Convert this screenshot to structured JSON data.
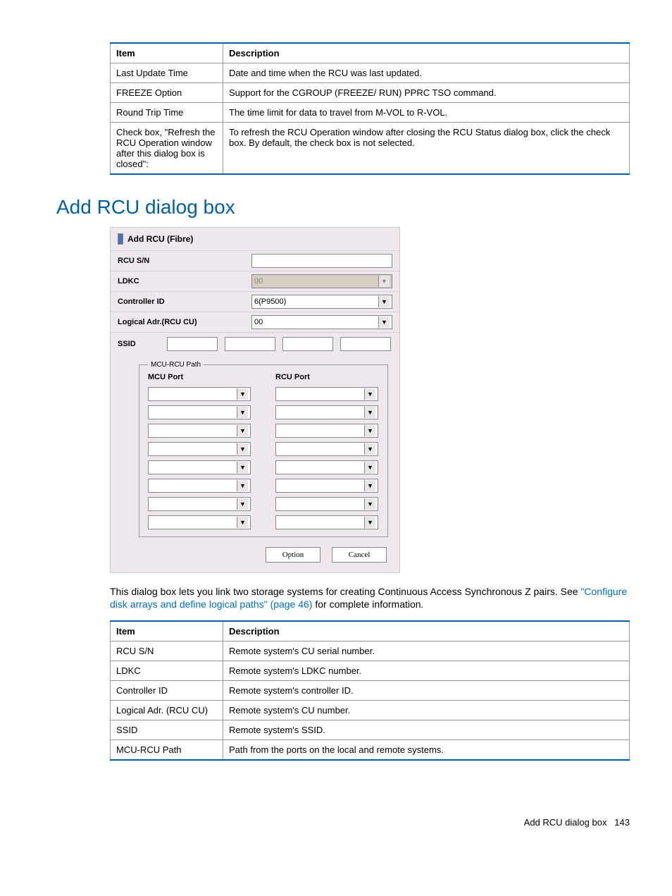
{
  "table1": {
    "headers": [
      "Item",
      "Description"
    ],
    "rows": [
      {
        "item": "Last Update Time",
        "desc": "Date and time when the RCU was last updated."
      },
      {
        "item": "FREEZE Option",
        "desc": "Support for the CGROUP (FREEZE/ RUN) PPRC TSO command."
      },
      {
        "item": "Round Trip Time",
        "desc": "The time limit for data to travel from M-VOL to R-VOL."
      },
      {
        "item": "Check box, \"Refresh the RCU Operation window after this dialog box is closed\":",
        "desc": "To refresh the RCU Operation window after closing the RCU Status dialog box, click the check box. By default, the check box is not selected."
      }
    ]
  },
  "section_title": "Add RCU dialog box",
  "dialog": {
    "title": "Add RCU (Fibre)",
    "labels": {
      "rcu_sn": "RCU S/N",
      "ldkc": "LDKC",
      "controller_id": "Controller ID",
      "logical_adr": "Logical Adr.(RCU CU)",
      "ssid": "SSID",
      "mcu_port": "MCU Port",
      "rcu_port": "RCU Port",
      "legend": "MCU-RCU Path"
    },
    "values": {
      "rcu_sn": "",
      "ldkc": "00",
      "controller_id": "6(P9500)",
      "logical_adr": "00"
    },
    "buttons": {
      "option": "Option",
      "cancel": "Cancel"
    },
    "path_rows": 8
  },
  "paragraph": {
    "pre": "This dialog box lets you link two storage systems for creating Continuous Access Synchronous Z pairs. See ",
    "link": "\"Configure disk arrays and define logical paths\" (page 46)",
    "post": " for complete information."
  },
  "table2": {
    "headers": [
      "Item",
      "Description"
    ],
    "rows": [
      {
        "item": "RCU S/N",
        "desc": "Remote system's CU serial number."
      },
      {
        "item": "LDKC",
        "desc": "Remote system's LDKC number."
      },
      {
        "item": "Controller ID",
        "desc": "Remote system's controller ID."
      },
      {
        "item": "Logical Adr. (RCU CU)",
        "desc": "Remote system's CU number."
      },
      {
        "item": "SSID",
        "desc": "Remote system's SSID."
      },
      {
        "item": "MCU-RCU Path",
        "desc": "Path from the ports on the local and remote systems."
      }
    ]
  },
  "footer": {
    "text": "Add RCU dialog box",
    "page": "143"
  }
}
